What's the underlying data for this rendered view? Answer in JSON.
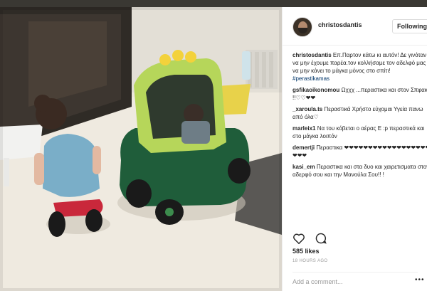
{
  "post": {
    "username": "christosdantis",
    "follow_label": "Following",
    "likes": "585 likes",
    "timestamp": "18 HOURS AGO",
    "add_comment_placeholder": "Add a comment...",
    "more_label": "•••"
  },
  "comments": [
    {
      "user": "christosdantis",
      "text": "Επ.Παρτον κάτω κι αυτόν! Δε γινόταν να μην έχουμε παρέα.τον κολλήσαμε τον αδελφό μας να μην κάνει το μάγκα μόνος στο σπίτι!",
      "hashtag": "#perastikamas"
    },
    {
      "user": "gsfikaoikonomou",
      "text": "Ωχχχ ...περαστικα και στον Σπφακο !!♡♡❤❤"
    },
    {
      "user": "_xaroula.ts",
      "text": "Περαστικά Χρήστο εύχομαι Υγεία πανω από όλα♡"
    },
    {
      "user": "marleix1",
      "text": "Να του κόβεται ο αέρας Ε :p περαστικά και στο μάγκα λοιπόν"
    },
    {
      "user": "demertji",
      "text": "Περαστικα ❤❤❤❤❤❤❤❤❤❤❤❤❤❤❤❤❤❤❤❤❤"
    },
    {
      "user": "kasi_em",
      "text": "Περαστικα και στα δυο και χαιρετισματα στον αδερφό σου και την Μανούλα Σου!! !"
    }
  ],
  "icons": {
    "like": "heart-icon",
    "comment": "comment-icon"
  }
}
